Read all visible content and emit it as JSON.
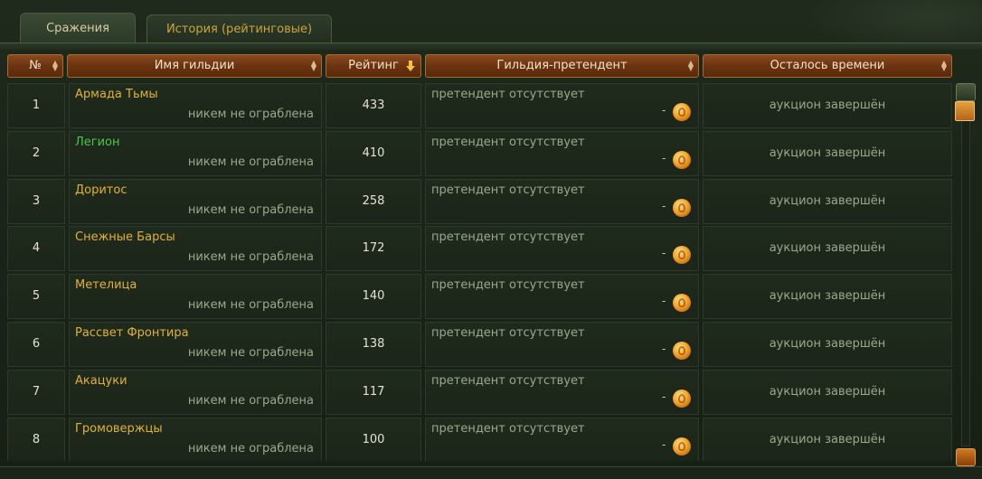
{
  "tabs": [
    {
      "label": "Сражения",
      "active": true
    },
    {
      "label": "История (рейтинговые)",
      "active": false
    }
  ],
  "columns": [
    {
      "label": "№"
    },
    {
      "label": "Имя гильдии"
    },
    {
      "label": "Рейтинг"
    },
    {
      "label": "Гильдия-претендент"
    },
    {
      "label": "Осталось времени"
    }
  ],
  "rows": [
    {
      "num": "1",
      "name": "Армада Тьмы",
      "name_color": "#e1b13a",
      "status": "никем не ограблена",
      "rating": "433",
      "claimant": "претендент отсутствует",
      "bid": "-",
      "time": "аукцион завершён"
    },
    {
      "num": "2",
      "name": "Легион",
      "name_color": "#48c84a",
      "status": "никем не ограблена",
      "rating": "410",
      "claimant": "претендент отсутствует",
      "bid": "-",
      "time": "аукцион завершён"
    },
    {
      "num": "3",
      "name": "Доритос",
      "name_color": "#e1b13a",
      "status": "никем не ограблена",
      "rating": "258",
      "claimant": "претендент отсутствует",
      "bid": "-",
      "time": "аукцион завершён"
    },
    {
      "num": "4",
      "name": "Снежные Барсы",
      "name_color": "#e1b13a",
      "status": "никем не ограблена",
      "rating": "172",
      "claimant": "претендент отсутствует",
      "bid": "-",
      "time": "аукцион завершён"
    },
    {
      "num": "5",
      "name": "Метелица",
      "name_color": "#e1b13a",
      "status": "никем не ограблена",
      "rating": "140",
      "claimant": "претендент отсутствует",
      "bid": "-",
      "time": "аукцион завершён"
    },
    {
      "num": "6",
      "name": "Рассвет Фронтира",
      "name_color": "#e1b13a",
      "status": "никем не ограблена",
      "rating": "138",
      "claimant": "претендент отсутствует",
      "bid": "-",
      "time": "аукцион завершён"
    },
    {
      "num": "7",
      "name": "Акацуки",
      "name_color": "#e1b13a",
      "status": "никем не ограблена",
      "rating": "117",
      "claimant": "претендент отсутствует",
      "bid": "-",
      "time": "аукцион завершён"
    },
    {
      "num": "8",
      "name": "Громовержцы",
      "name_color": "#e1b13a",
      "status": "никем не ограблена",
      "rating": "100",
      "claimant": "претендент отсутствует",
      "bid": "-",
      "time": "аукцион завершён"
    }
  ],
  "icons": {
    "sort": "sort-arrows-icon",
    "sort_active": "sort-down-arrow-icon",
    "coin": "gold-coin-icon"
  },
  "colors": {
    "header": "#6b3310",
    "gold_text": "#e1b13a",
    "ally_text": "#48c84a",
    "muted_text": "#9aa88e"
  }
}
